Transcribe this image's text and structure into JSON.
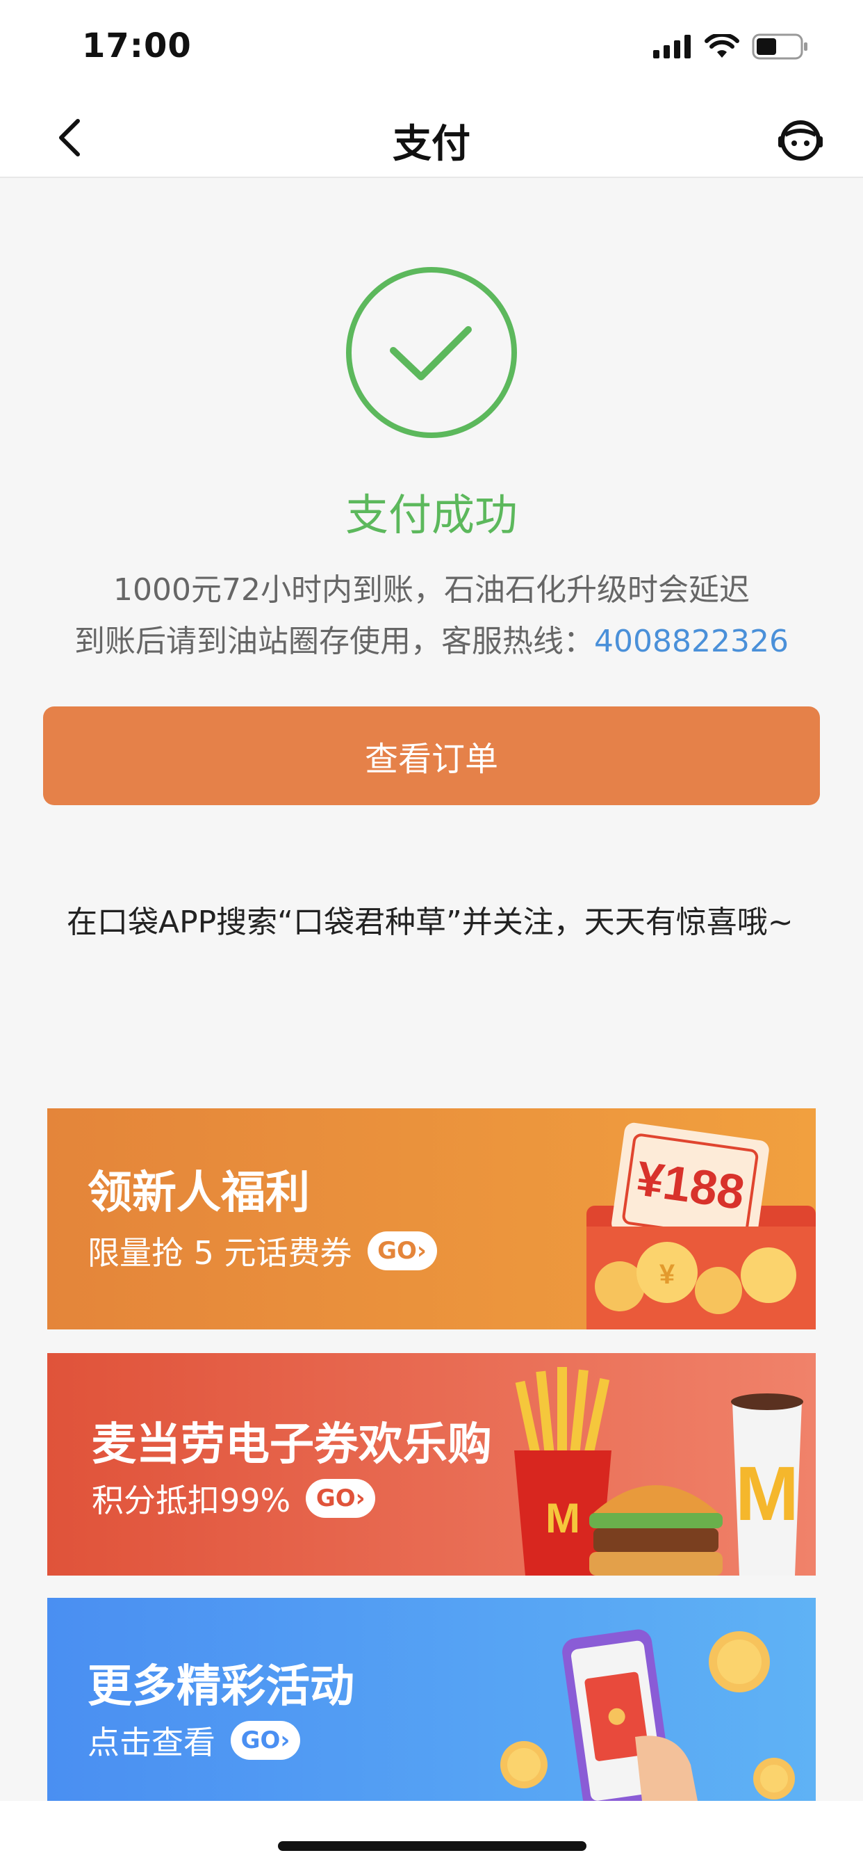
{
  "status_bar": {
    "time": "17:00"
  },
  "nav": {
    "title": "支付"
  },
  "success": {
    "title": "支付成功",
    "notice_line1": "1000元72小时内到账，石油石化升级时会延迟",
    "notice_line2_prefix": "到账后请到油站圈存使用，客服热线：",
    "hotline": "4008822326"
  },
  "order_button": {
    "label": "查看订单"
  },
  "tip": {
    "text": "在口袋APP搜索“口袋君种草”并关注，天天有惊喜哦~"
  },
  "banners": [
    {
      "title": "领新人福利",
      "subtitle": "限量抢 5 元话费券",
      "go": "GO",
      "art_label": "¥188",
      "color": "#e4853a"
    },
    {
      "title": "麦当劳电子券欢乐购",
      "subtitle": "积分抵扣99%",
      "go": "GO",
      "color": "#e0533a"
    },
    {
      "title": "更多精彩活动",
      "subtitle": "点击查看",
      "go": "GO",
      "color": "#4a8ff2"
    }
  ],
  "colors": {
    "success": "#5cb85c",
    "accent": "#e58149",
    "link": "#4a90d9"
  }
}
